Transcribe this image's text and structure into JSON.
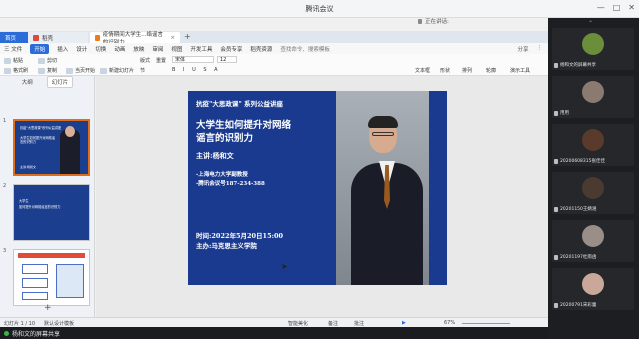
{
  "meeting": {
    "title": "腾讯会议",
    "speaking_label": "正在讲话:",
    "window_controls": [
      "—",
      "□",
      "✕"
    ]
  },
  "wps": {
    "tabs": [
      {
        "label": "首页"
      },
      {
        "label": "稻壳"
      },
      {
        "label": "疫情期间大学生...络谣言的识别力"
      }
    ],
    "menu": {
      "file": "三 文件",
      "items": [
        "开始",
        "插入",
        "设计",
        "切换",
        "动画",
        "放映",
        "审阅",
        "视图",
        "开发工具",
        "会员专享",
        "稻壳资源"
      ],
      "active_index": 0,
      "search": "查找命令、搜索模板",
      "right": [
        "分享",
        "⋮"
      ]
    },
    "ribbon": {
      "paste": "粘贴",
      "format_painter": "格式刷",
      "cut": "剪切",
      "copy": "复制",
      "current_start": "当页开始",
      "new_slide": "新建幻灯片",
      "layout": "版式",
      "section": "节",
      "reset": "重置",
      "font": "宋体",
      "font_size": "12",
      "textbox": "文本框",
      "shape": "形状",
      "arrange": "排列",
      "outline": "轮廓",
      "slideshow": "演示工具"
    },
    "left_pane": {
      "tabs": [
        "大纲",
        "幻灯片"
      ],
      "active_tab": 1,
      "thumbs": [
        {
          "num": "1",
          "line1": "抗疫\"大思政课\"系列公益讲座",
          "line2": "大学生如何提升对网络谣言的识别力",
          "cap": "主讲:杨和文"
        },
        {
          "num": "2",
          "line1": "大学生",
          "line2": "如何提升对网络谣言的识别力"
        },
        {
          "num": "3",
          "line1": "",
          "line2": ""
        }
      ],
      "add": "+"
    },
    "slide": {
      "series": "抗疫\"大思政课\" 系列公益讲座",
      "title_line1": "大学生如何提升对网络",
      "title_line2": "谣言的识别力",
      "presenter": "主讲:杨和文",
      "aff_line1": "-上海电力大学副教授",
      "aff_line2": "-腾讯会议号187-234-388",
      "time_line": "时间:2022年5月20日15:00",
      "host_line": "主办:马克思主义学院"
    },
    "statusbar": {
      "slide_count": "幻灯片 1 / 10",
      "theme": "默认设计模板",
      "smart_beautify": "智能美化",
      "notes": "备注",
      "comments": "批注",
      "zoom": "67%"
    }
  },
  "share_banner": "杨和文的屏幕共享",
  "participants": [
    {
      "name": "杨和文的屏幕共享"
    },
    {
      "name": "用用"
    },
    {
      "name": "20200608315张佳佳"
    },
    {
      "name": "20201150王婧涵"
    },
    {
      "name": "20201197杜雨函"
    },
    {
      "name": "20200791宋彩蕾"
    }
  ],
  "colors": {
    "wps_blue": "#2b6cd8",
    "slide_blue": "#1a3a8f",
    "selection_orange": "#e06d1a"
  }
}
